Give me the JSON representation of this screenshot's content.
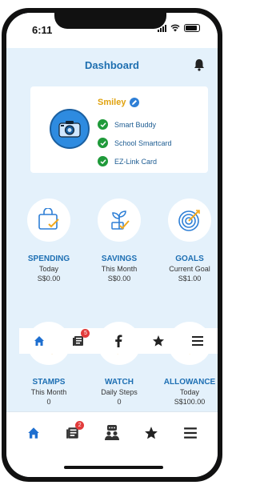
{
  "status_bar": {
    "time": "6:11"
  },
  "header": {
    "title": "Dashboard",
    "icon": "bell-icon"
  },
  "profile": {
    "name": "Smiley",
    "cards": [
      {
        "label": "Smart Buddy"
      },
      {
        "label": "School Smartcard"
      },
      {
        "label": "EZ-Link Card"
      }
    ]
  },
  "tiles_row1": [
    {
      "title": "SPENDING",
      "subtitle": "Today",
      "value": "S$0.00",
      "icon": "shopping-bag-icon"
    },
    {
      "title": "SAVINGS",
      "subtitle": "This Month",
      "value": "S$0.00",
      "icon": "plant-growth-icon"
    },
    {
      "title": "GOALS",
      "subtitle": "Current Goal",
      "value": "S$1.00",
      "icon": "target-icon"
    }
  ],
  "tiles_row2": [
    {
      "title": "STAMPS",
      "subtitle": "This Month",
      "value": "0",
      "icon": "stamp-icon"
    },
    {
      "title": "WATCH",
      "subtitle": "Daily Steps",
      "value": "0",
      "icon": "watch-icon"
    },
    {
      "title": "ALLOWANCE",
      "subtitle": "Today",
      "value": "S$100.00",
      "icon": "allowance-icon"
    }
  ],
  "floating_nav": {
    "badge": "5",
    "items": [
      "home-icon",
      "news-icon",
      "facebook-icon",
      "star-icon",
      "menu-icon"
    ]
  },
  "tabbar": {
    "badge": "2",
    "items": [
      "home-icon",
      "news-icon",
      "family-chat-icon",
      "star-icon",
      "menu-icon"
    ]
  },
  "colors": {
    "accent": "#1e6fb0",
    "background": "#e4f1fb",
    "name": "#e0a20e",
    "check": "#1f9a3a",
    "badge": "#e23b3b"
  }
}
